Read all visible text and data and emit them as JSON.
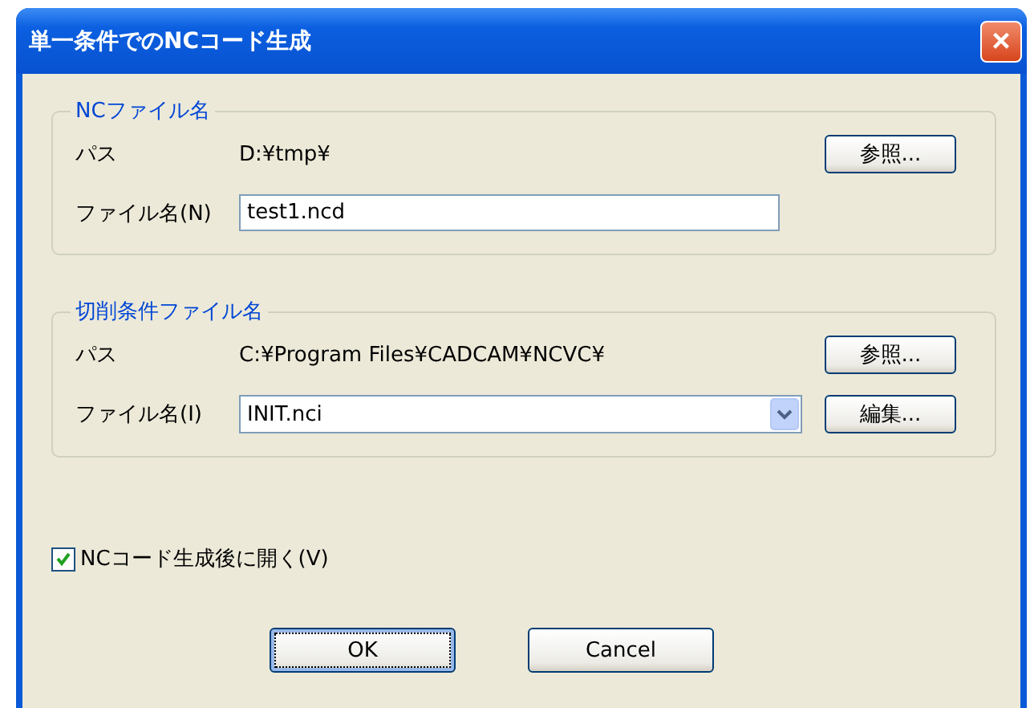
{
  "window": {
    "title": "単一条件でのNCコード生成",
    "close": "×"
  },
  "groups": [
    {
      "title": "NCファイル名",
      "path_label": "パス",
      "path": "D:¥tmp¥",
      "browse_button": "参照...",
      "file_label": "ファイル名(N)",
      "file_value": "test1.ncd",
      "kind": "text"
    },
    {
      "title": "切削条件ファイル名",
      "path_label": "パス",
      "path": "C:¥Program Files¥CADCAM¥NCVC¥",
      "browse_button": "参照...",
      "file_label": "ファイル名(I)",
      "file_value": "INIT.nci",
      "kind": "combo",
      "edit_button": "編集..."
    }
  ],
  "open_after": {
    "label": "NCコード生成後に開く(V)",
    "checked": true
  },
  "buttons": [
    {
      "label": "OK",
      "default": true
    },
    {
      "label": "Cancel",
      "default": false
    }
  ]
}
